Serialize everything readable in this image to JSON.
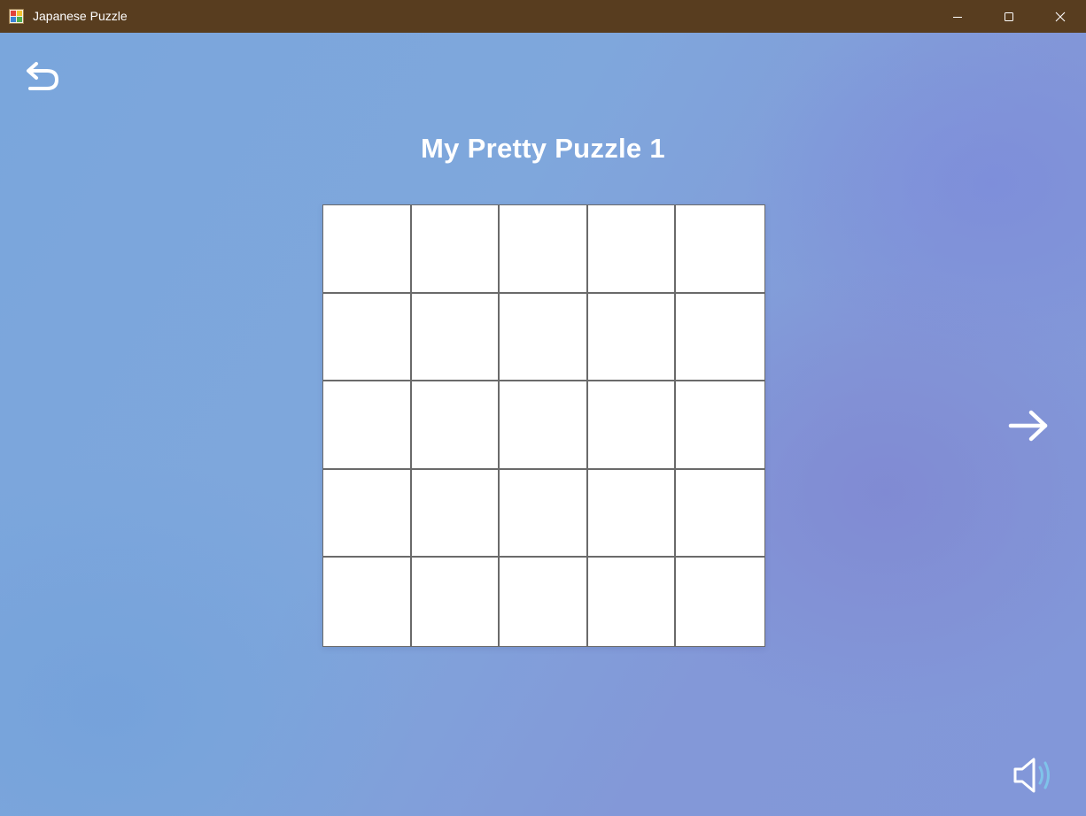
{
  "window": {
    "title": "Japanese Puzzle",
    "controls": [
      {
        "name": "minimize-icon"
      },
      {
        "name": "maximize-icon"
      },
      {
        "name": "close-icon"
      }
    ]
  },
  "header": {
    "back_icon": "undo-arrow-icon"
  },
  "puzzle": {
    "title": "My Pretty Puzzle 1",
    "rows": 5,
    "cols": 5,
    "cells": [
      [
        0,
        0,
        0,
        0,
        0
      ],
      [
        0,
        0,
        0,
        0,
        0
      ],
      [
        0,
        0,
        0,
        0,
        0
      ],
      [
        0,
        0,
        0,
        0,
        0
      ],
      [
        0,
        0,
        0,
        0,
        0
      ]
    ]
  },
  "navigation": {
    "next_icon": "right-arrow-icon",
    "sound_icon": "speaker-icon"
  },
  "colors": {
    "titlebar": "#583d1f",
    "grid_line": "#6a6a6a",
    "cell_empty": "#ffffff",
    "text": "#ffffff",
    "sound_waves": "#7fc3ea"
  }
}
